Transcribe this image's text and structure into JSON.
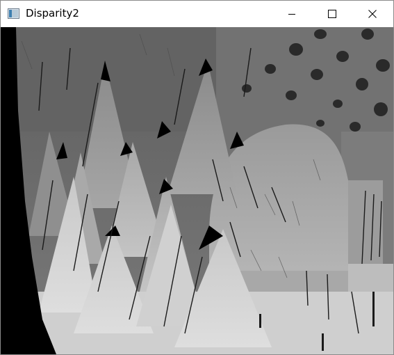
{
  "window": {
    "title": "Disparity2"
  },
  "titlebar": {
    "app_icon": "app-window-icon",
    "minimize_icon": "minimize-icon",
    "maximize_icon": "maximize-icon",
    "close_icon": "close-icon"
  },
  "image": {
    "content": "disparity-map-grayscale"
  }
}
